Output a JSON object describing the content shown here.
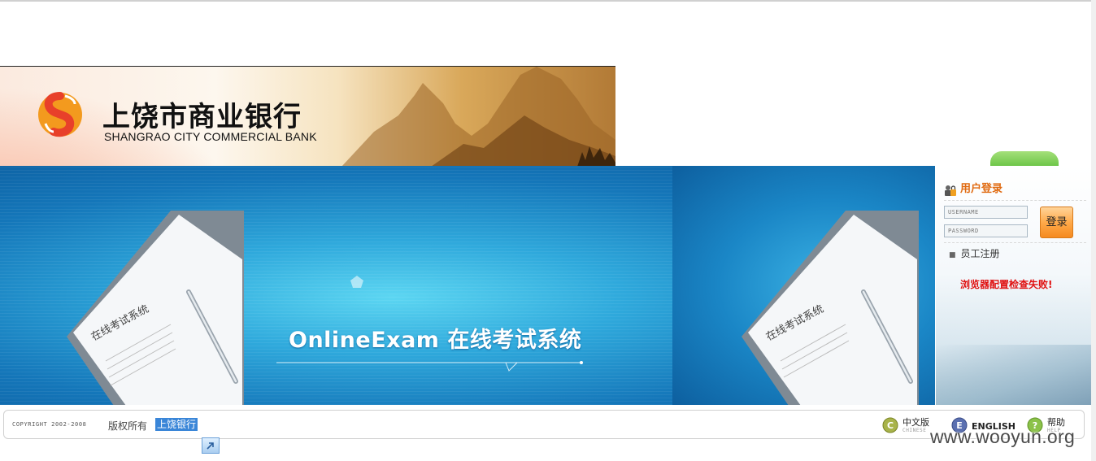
{
  "header": {
    "brand_cn": "上饶市商业银行",
    "brand_en": "SHANGRAO CITY COMMERCIAL BANK",
    "logo_icon": "bank-logo-icon",
    "colors": {
      "logo_red": "#e8402a",
      "logo_orange": "#f39a1e"
    }
  },
  "hero": {
    "title": "OnlineExam 在线考试系统",
    "paper_text": "在线考试系统"
  },
  "login": {
    "title": "用户登录",
    "username_placeholder": "USERNAME",
    "password_placeholder": "PASSWORD",
    "submit_label": "登录",
    "register_label": "员工注册",
    "browser_warning": "浏览器配置检查失败!",
    "colors": {
      "title": "#e06a10",
      "warning": "#e01010",
      "button": "#f58a20"
    }
  },
  "footer": {
    "copyright": "COPYRIGHT 2002-2008",
    "rights": "版权所有",
    "bank_name": "上饶银行",
    "languages": [
      {
        "label": "中文版",
        "sub": "CHINESE",
        "icon": "chinese-c-icon"
      },
      {
        "label": "ENGLISH",
        "sub": "",
        "icon": "english-e-icon"
      },
      {
        "label": "帮助",
        "sub": "HELP",
        "icon": "help-question-icon"
      }
    ]
  },
  "watermark": "www.wooyun.org"
}
